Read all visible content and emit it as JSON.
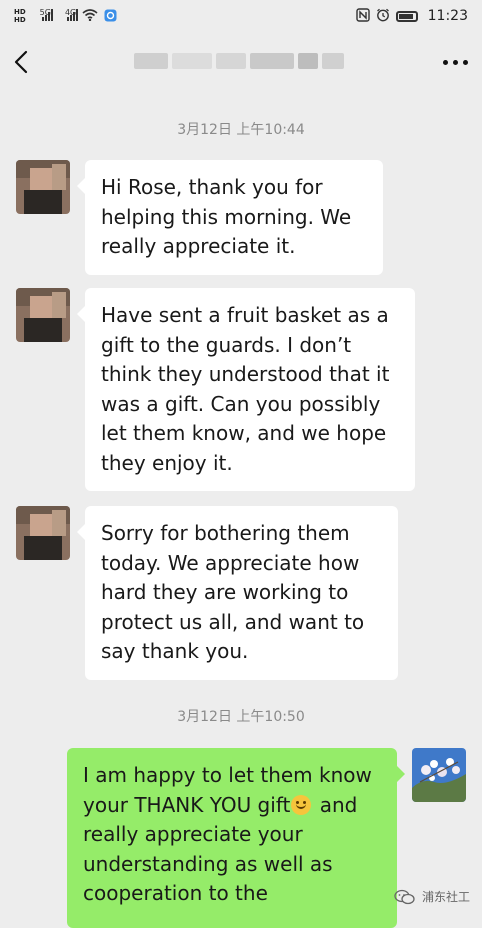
{
  "status_bar": {
    "hd_top": "HD",
    "hd_bottom": "HD",
    "signal1": "5G",
    "signal2": "4G",
    "time": "11:23",
    "icons": [
      "signal-icon",
      "wifi-icon",
      "app-notification-icon",
      "nfc-icon",
      "alarm-icon",
      "battery-icon"
    ]
  },
  "nav": {
    "back_icon": "chevron-left-icon",
    "more_icon": "more-dots-icon"
  },
  "conversation": {
    "timestamp_1": "3月12日 上午10:44",
    "messages_left": [
      {
        "lines": [
          "Hi Rose, thank you for",
          "helping this morning. We",
          "really appreciate it."
        ]
      },
      {
        "lines": [
          "Have sent a fruit basket as a",
          "gift to the guards. I don’t",
          "think they understood that it",
          "was a gift. Can you possibly",
          "let them know, and we hope",
          "they enjoy it."
        ]
      },
      {
        "lines": [
          "Sorry for bothering them",
          "today. We appreciate how",
          "hard they are working to",
          "protect us all, and want to",
          "say thank you."
        ]
      }
    ],
    "timestamp_2": "3月12日 上午10:50",
    "message_right": {
      "line1": "I am happy to let them know",
      "line2_before": "your THANK YOU gift",
      "line2_after": " and",
      "emoji": "smiling-face-emoji",
      "line3": "really appreciate your",
      "line4": "understanding as well as",
      "line5": "cooperation to the"
    }
  },
  "watermark": {
    "text": "浦东社工"
  },
  "colors": {
    "background": "#ededed",
    "bubble_incoming": "#ffffff",
    "bubble_outgoing": "#95ec69",
    "timestamp": "#8a8a8a"
  }
}
